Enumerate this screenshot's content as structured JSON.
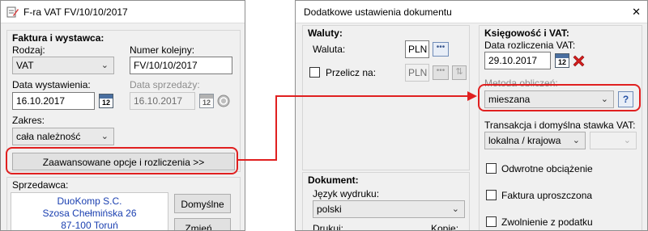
{
  "left_window": {
    "title": "F-ra VAT FV/10/10/2017",
    "group_title": "Faktura i wystawca:",
    "rodzaj": {
      "label": "Rodzaj:",
      "value": "VAT"
    },
    "numer": {
      "label": "Numer kolejny:",
      "value": "FV/10/10/2017"
    },
    "data_wystawienia": {
      "label": "Data wystawienia:",
      "value": "16.10.2017"
    },
    "data_sprzedazy": {
      "label": "Data sprzedaży:",
      "value": "16.10.2017"
    },
    "zakres": {
      "label": "Zakres:",
      "value": "cała należność"
    },
    "advanced_button": "Zaawansowane opcje i rozliczenia >>",
    "sprzedawca": {
      "label": "Sprzedawca:",
      "lines": [
        "DuoKomp S.C.",
        "Szosa Chełmińska 26",
        "87-100 Toruń"
      ],
      "default_button": "Domyślne",
      "change_button": "Zmień..."
    },
    "calendar_number": "12"
  },
  "right_window": {
    "title": "Dodatkowe ustawienia dokumentu",
    "close_glyph": "✕",
    "waluty": {
      "title": "Waluty:",
      "waluta_label": "Waluta:",
      "waluta_value": "PLN",
      "przelicz_label": "Przelicz na:",
      "przelicz_value": "PLN"
    },
    "dokument": {
      "title": "Dokument:",
      "jezyk_label": "Język wydruku:",
      "jezyk_value": "polski",
      "drukuj_label": "Drukuj:",
      "kopie_label": "Kopie:"
    },
    "ksiegowosc": {
      "title": "Księgowość i VAT:",
      "data_label": "Data rozliczenia VAT:",
      "data_value": "29.10.2017",
      "metoda_label": "Metoda obliczeń:",
      "metoda_value": "mieszana",
      "help_glyph": "?",
      "transakcja_label": "Transakcja i domyślna stawka VAT:",
      "transakcja_value": "lokalna / krajowa",
      "checkboxes": [
        "Odwrotne obciążenie",
        "Faktura uproszczona",
        "Zwolnienie z podatku"
      ]
    },
    "calendar_number": "12"
  },
  "colors": {
    "highlight_red": "#e02020",
    "link_blue": "#1a3fb0"
  },
  "icons": [
    "document-edit-icon",
    "calendar-icon",
    "refresh-icon",
    "ellipsis-icon",
    "delete-x-icon",
    "help-icon",
    "dropdown-arrow-icon"
  ]
}
